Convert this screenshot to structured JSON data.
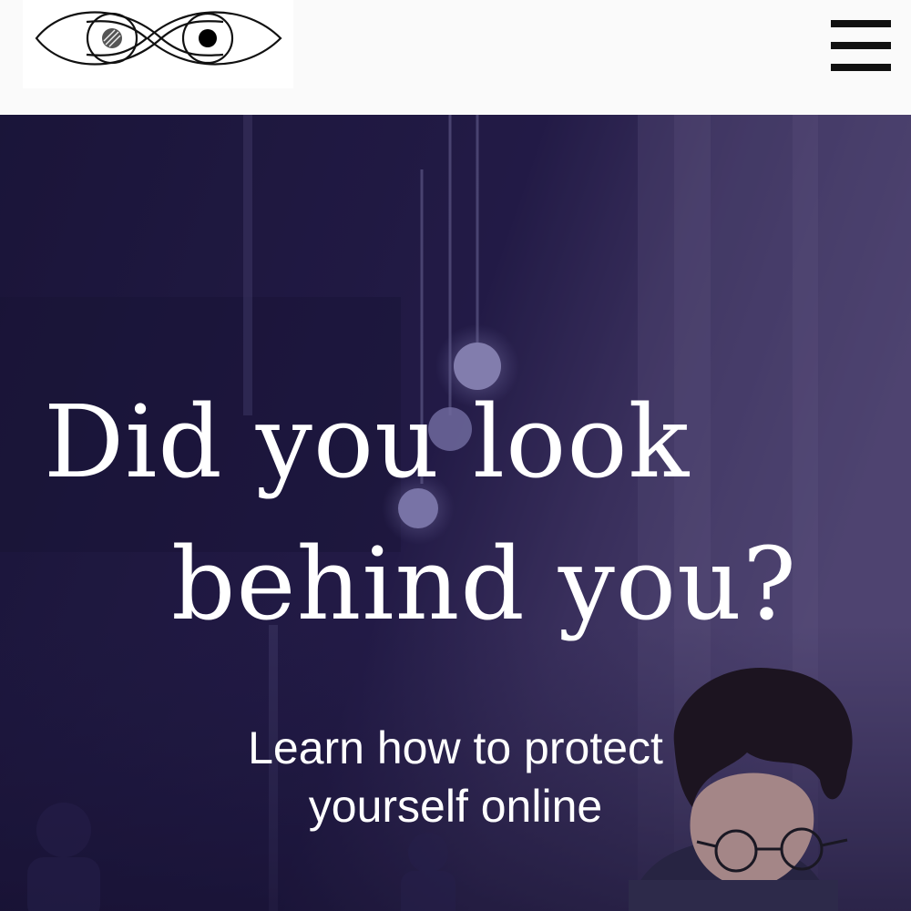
{
  "header": {
    "logo_icon": "eyes-logo-icon",
    "menu_icon": "hamburger-menu-icon"
  },
  "hero": {
    "headline_line1": "Did you look",
    "headline_line2": "behind you?",
    "subtitle_line1": "Learn how to protect",
    "subtitle_line2": "yourself online",
    "overlay_color": "#1b163d",
    "text_color": "#ffffff"
  }
}
